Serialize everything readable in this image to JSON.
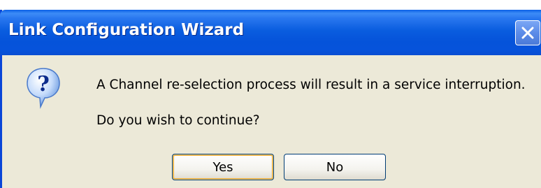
{
  "window": {
    "title": "Link Configuration Wizard"
  },
  "dialog": {
    "icon": "question-icon",
    "message": "A Channel re-selection process will result in a service interruption.",
    "prompt": "Do you wish to continue?"
  },
  "buttons": {
    "yes_label": "Yes",
    "no_label": "No"
  },
  "colors": {
    "titlebar": "#0a5ddf",
    "body": "#ece9d8",
    "button_border": "#003c74",
    "default_button_focus": "#e5a737"
  }
}
